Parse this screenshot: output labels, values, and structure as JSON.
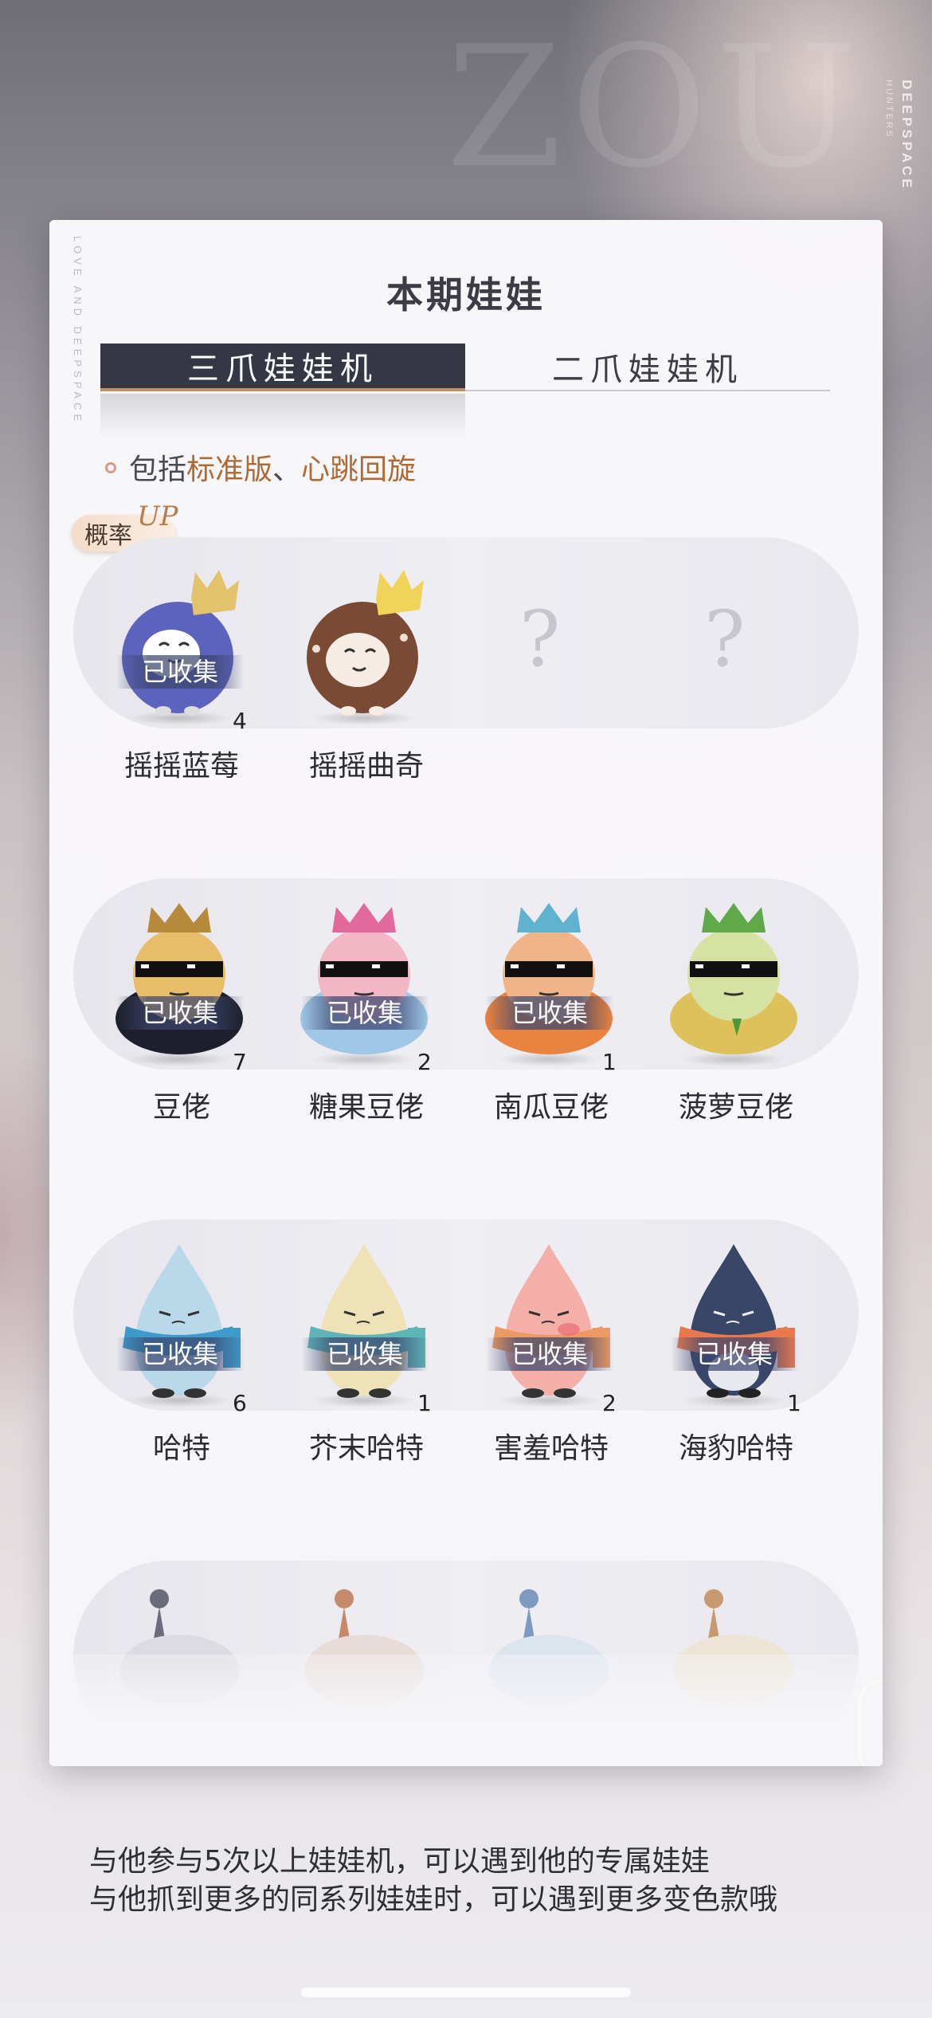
{
  "brand": {
    "vertical": "DEEPSPACE",
    "vertical_sub": "HUNTERS",
    "background_text": "ZOU"
  },
  "panel": {
    "deco_vertical": "LOVE AND DEEPSPACE",
    "title": "本期娃娃",
    "tabs": [
      {
        "label": "三爪娃娃机",
        "active": true
      },
      {
        "label": "二爪娃娃机",
        "active": false
      }
    ],
    "includes": {
      "prefix": "包括",
      "item1": "标准版",
      "sep": "、",
      "item2": "心跳回旋"
    },
    "rate_badge": {
      "label": "概率",
      "up": "UP"
    },
    "collected_label": "已收集",
    "unknown_symbol": "?",
    "rows": [
      {
        "dolls": [
          {
            "name": "摇摇蓝莓",
            "collected": true,
            "count": "4",
            "color": "#5c63bd",
            "crown": "#e2c26b"
          },
          {
            "name": "摇摇曲奇",
            "collected": false,
            "count": "",
            "color": "#7a4a35",
            "crown": "#f1d35a"
          },
          {
            "name": "",
            "collected": false,
            "count": "",
            "unknown": true
          },
          {
            "name": "",
            "collected": false,
            "count": "",
            "unknown": true
          }
        ]
      },
      {
        "dolls": [
          {
            "name": "豆佬",
            "collected": true,
            "count": "7",
            "color": "#e7bd6a",
            "crown": "#b7893b",
            "suit": "#1d1f2c"
          },
          {
            "name": "糖果豆佬",
            "collected": true,
            "count": "2",
            "color": "#f2b6c4",
            "crown": "#e3689b",
            "suit": "#9fc7e6"
          },
          {
            "name": "南瓜豆佬",
            "collected": true,
            "count": "1",
            "color": "#efb488",
            "crown": "#5fb3cf",
            "suit": "#e9833f"
          },
          {
            "name": "菠萝豆佬",
            "collected": false,
            "count": "",
            "color": "#d6e2a1",
            "crown": "#5fa94a",
            "suit": "#ddc15a"
          }
        ]
      },
      {
        "dolls": [
          {
            "name": "哈特",
            "collected": true,
            "count": "6",
            "color": "#b9d8ea",
            "scarf": "#3d9acb"
          },
          {
            "name": "芥末哈特",
            "collected": true,
            "count": "1",
            "color": "#efe2b6",
            "scarf": "#5db4b9"
          },
          {
            "name": "害羞哈特",
            "collected": true,
            "count": "2",
            "color": "#f4b0a8",
            "scarf": "#ec9a63"
          },
          {
            "name": "海豹哈特",
            "collected": true,
            "count": "1",
            "color": "#384667",
            "scarf": "#e8794f"
          }
        ]
      },
      {
        "faded": true,
        "dolls": [
          {
            "color": "#6b6b7a"
          },
          {
            "color": "#c58a6a"
          },
          {
            "color": "#7e9ac0"
          },
          {
            "color": "#c79a70"
          }
        ]
      }
    ]
  },
  "info": {
    "line1": "与他参与5次以上娃娃机，可以遇到他的专属娃娃",
    "line2": "与他抓到更多的同系列娃娃时，可以遇到更多变色款哦"
  }
}
